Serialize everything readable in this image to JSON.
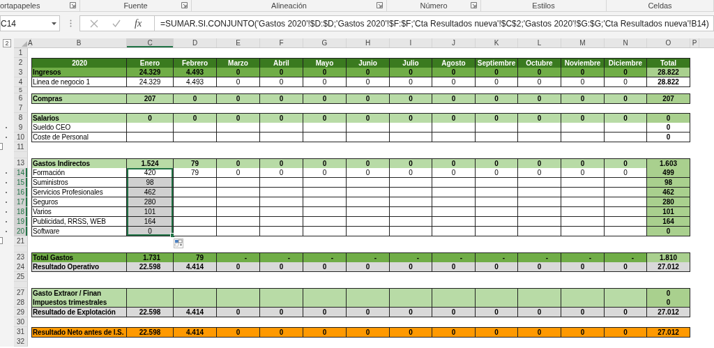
{
  "ribbon": {
    "groups": [
      {
        "label": "ortapapeles",
        "launcher": true
      },
      {
        "label": "Fuente",
        "launcher": true
      },
      {
        "label": "Alineación",
        "launcher": true
      },
      {
        "label": "Número",
        "launcher": true
      },
      {
        "label": "Estilos",
        "launcher": false
      },
      {
        "label": "Celdas",
        "launcher": false
      }
    ]
  },
  "formula_bar": {
    "name_box": "C14",
    "function_label": "fx",
    "formula": "=SUMAR.SI.CONJUNTO('Gastos 2020'!$D:$D;'Gastos 2020'!$F:$F;'Cta Resultados nueva'!$C$2;'Gastos 2020'!$G:$G;'Cta Resultados nueva'!B14)"
  },
  "outline_level": "2",
  "columns": [
    {
      "label": "A",
      "selected": false
    },
    {
      "label": "B",
      "selected": false
    },
    {
      "label": "C",
      "selected": true
    },
    {
      "label": "D",
      "selected": false
    },
    {
      "label": "E",
      "selected": false
    },
    {
      "label": "F",
      "selected": false
    },
    {
      "label": "G",
      "selected": false
    },
    {
      "label": "H",
      "selected": false
    },
    {
      "label": "I",
      "selected": false
    },
    {
      "label": "J",
      "selected": false
    },
    {
      "label": "K",
      "selected": false
    },
    {
      "label": "L",
      "selected": false
    },
    {
      "label": "M",
      "selected": false
    },
    {
      "label": "N",
      "selected": false
    },
    {
      "label": "O",
      "selected": false
    },
    {
      "label": "P",
      "selected": false
    }
  ],
  "rows": [
    {
      "number": "1",
      "kind": "blank",
      "selected": false,
      "grouped": false,
      "collapse_button": false
    },
    {
      "number": "2",
      "kind": "header",
      "selected": false,
      "grouped": false,
      "collapse_button": false,
      "label": "2020",
      "values": [
        "Enero",
        "Febrero",
        "Marzo",
        "Abril",
        "Mayo",
        "Junio",
        "Julio",
        "Agosto",
        "Septiembre",
        "Octubre",
        "Noviembre",
        "Diciembre"
      ],
      "total": {
        "text": "Total",
        "kind": "header"
      }
    },
    {
      "number": "3",
      "kind": "dark",
      "selected": false,
      "grouped": false,
      "collapse_button": false,
      "label": "Ingresos",
      "values": [
        "24.329",
        "4.493",
        "0",
        "0",
        "0",
        "0",
        "0",
        "0",
        "0",
        "0",
        "0",
        "0"
      ],
      "total": {
        "text": "28.822",
        "kind": "mid"
      }
    },
    {
      "number": "4",
      "kind": "plain",
      "selected": false,
      "grouped": false,
      "collapse_button": false,
      "label": "Linea de negocio 1",
      "values": [
        "24.329",
        "4.493",
        "0",
        "0",
        "0",
        "0",
        "0",
        "0",
        "0",
        "0",
        "0",
        "0"
      ],
      "total": {
        "text": "28.822",
        "kind": "bold"
      }
    },
    {
      "number": "5",
      "kind": "thin",
      "selected": false,
      "grouped": false,
      "collapse_button": false
    },
    {
      "number": "6",
      "kind": "light",
      "selected": false,
      "grouped": false,
      "collapse_button": false,
      "label": "Compras",
      "values": [
        "207",
        "0",
        "0",
        "0",
        "0",
        "0",
        "0",
        "0",
        "0",
        "0",
        "0",
        "0"
      ],
      "total": {
        "text": "207",
        "kind": "mid"
      }
    },
    {
      "number": "7",
      "kind": "blank",
      "selected": false,
      "grouped": false,
      "collapse_button": false
    },
    {
      "number": "8",
      "kind": "light",
      "selected": false,
      "grouped": false,
      "collapse_button": false,
      "label": "Salarios",
      "values": [
        "0",
        "0",
        "0",
        "0",
        "0",
        "0",
        "0",
        "0",
        "0",
        "0",
        "0",
        "0"
      ],
      "total": {
        "text": "0",
        "kind": "mid"
      }
    },
    {
      "number": "9",
      "kind": "plain",
      "selected": false,
      "grouped": true,
      "collapse_button": false,
      "label": "Sueldo CEO",
      "total": {
        "text": "0",
        "kind": "bold"
      }
    },
    {
      "number": "10",
      "kind": "plain",
      "selected": false,
      "grouped": true,
      "collapse_button": false,
      "label": "Coste de Personal",
      "total": {
        "text": "0",
        "kind": "bold"
      }
    },
    {
      "number": "11",
      "kind": "blank",
      "selected": false,
      "grouped": false,
      "collapse_button": true
    },
    {
      "kind": "thin",
      "selected": false,
      "grouped": false,
      "collapse_button": false
    },
    {
      "number": "13",
      "kind": "light",
      "selected": false,
      "grouped": false,
      "collapse_button": false,
      "label": "Gastos Indirectos",
      "values": [
        "1.524",
        "79",
        "0",
        "0",
        "0",
        "0",
        "0",
        "0",
        "0",
        "0",
        "0",
        "0"
      ],
      "total": {
        "text": "1.603",
        "kind": "mid"
      }
    },
    {
      "number": "14",
      "kind": "plain",
      "selected": true,
      "grouped": true,
      "collapse_button": false,
      "label": "Formación",
      "values": [
        "420",
        "79",
        "0",
        "0",
        "0",
        "0",
        "0",
        "0",
        "0",
        "0",
        "0",
        "0"
      ],
      "total": {
        "text": "499",
        "kind": "mid"
      }
    },
    {
      "number": "15",
      "kind": "plain",
      "selected": true,
      "grouped": true,
      "collapse_button": false,
      "label": "Suministros",
      "values": [
        "98"
      ],
      "total": {
        "text": "98",
        "kind": "mid"
      }
    },
    {
      "number": "16",
      "kind": "plain",
      "selected": true,
      "grouped": true,
      "collapse_button": false,
      "label": "Servicios Profesionales",
      "values": [
        "462"
      ],
      "total": {
        "text": "462",
        "kind": "mid"
      }
    },
    {
      "number": "17",
      "kind": "plain",
      "selected": true,
      "grouped": true,
      "collapse_button": false,
      "label": "Seguros",
      "values": [
        "280"
      ],
      "total": {
        "text": "280",
        "kind": "mid"
      }
    },
    {
      "number": "18",
      "kind": "plain",
      "selected": true,
      "grouped": true,
      "collapse_button": false,
      "label": "Varios",
      "values": [
        "101"
      ],
      "total": {
        "text": "101",
        "kind": "mid"
      }
    },
    {
      "number": "19",
      "kind": "plain",
      "selected": true,
      "grouped": true,
      "collapse_button": false,
      "label": "Publicidad, RRSS, WEB",
      "values": [
        "164"
      ],
      "total": {
        "text": "164",
        "kind": "mid"
      }
    },
    {
      "number": "20",
      "kind": "plain",
      "selected": true,
      "grouped": true,
      "collapse_button": false,
      "label": "Software",
      "values": [
        "0"
      ],
      "total": {
        "text": "0",
        "kind": "mid"
      }
    },
    {
      "number": "21",
      "kind": "blank",
      "selected": false,
      "grouped": false,
      "collapse_button": true
    },
    {
      "kind": "thin",
      "selected": false,
      "grouped": false,
      "collapse_button": false
    },
    {
      "number": "23",
      "kind": "dark",
      "selected": false,
      "grouped": false,
      "collapse_button": false,
      "label": "Total Gastos",
      "values": [
        "1.731",
        "79",
        "-",
        "-",
        "-",
        "-",
        "-",
        "-",
        "-",
        "-",
        "-",
        "-"
      ],
      "total": {
        "text": "1.810",
        "kind": "mid"
      },
      "accounting_format": true
    },
    {
      "number": "24",
      "kind": "grey",
      "selected": false,
      "grouped": false,
      "collapse_button": false,
      "label": "Resultado Operativo",
      "values": [
        "22.598",
        "4.414",
        "0",
        "0",
        "0",
        "0",
        "0",
        "0",
        "0",
        "0",
        "0",
        "0"
      ],
      "total": {
        "text": "27.012",
        "kind": "grey"
      }
    },
    {
      "number": "25",
      "kind": "blank",
      "selected": false,
      "grouped": false,
      "collapse_button": false
    },
    {
      "kind": "thin",
      "selected": false,
      "grouped": false,
      "collapse_button": false
    },
    {
      "number": "27",
      "kind": "light",
      "selected": false,
      "grouped": false,
      "collapse_button": false,
      "label": "Gasto Extraor / Finan",
      "total": {
        "text": "0",
        "kind": "mid"
      }
    },
    {
      "number": "28",
      "kind": "light",
      "selected": false,
      "grouped": false,
      "collapse_button": false,
      "label": "Impuestos trimestrales",
      "total": {
        "text": "0",
        "kind": "mid"
      }
    },
    {
      "number": "29",
      "kind": "grey",
      "selected": false,
      "grouped": false,
      "collapse_button": false,
      "label": "Resultado de Explotación",
      "values": [
        "22.598",
        "4.414",
        "0",
        "0",
        "0",
        "0",
        "0",
        "0",
        "0",
        "0",
        "0",
        "0"
      ],
      "total": {
        "text": "27.012",
        "kind": "grey"
      }
    },
    {
      "number": "30",
      "kind": "blank",
      "selected": false,
      "grouped": false,
      "collapse_button": false
    },
    {
      "number": "31",
      "kind": "orange",
      "selected": false,
      "grouped": false,
      "collapse_button": false,
      "label": "Resultado Neto antes de I.S.",
      "values": [
        "22.598",
        "4.414",
        "0",
        "0",
        "0",
        "0",
        "0",
        "0",
        "0",
        "0",
        "0",
        "0"
      ],
      "total": {
        "text": "27.012",
        "kind": "orange"
      }
    },
    {
      "number": "32",
      "kind": "blank",
      "selected": false,
      "grouped": false,
      "collapse_button": false
    }
  ]
}
